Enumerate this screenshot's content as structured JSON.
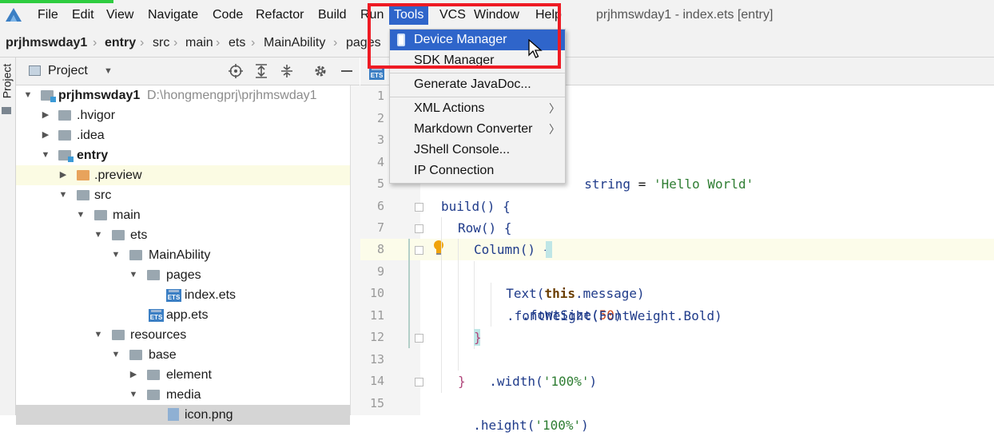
{
  "menu": {
    "items": [
      "File",
      "Edit",
      "View",
      "Navigate",
      "Code",
      "Refactor",
      "Build",
      "Run",
      "Tools",
      "VCS",
      "Window",
      "Help"
    ],
    "active": "Tools",
    "window_title": "prjhmswday1 - index.ets [entry]"
  },
  "breadcrumb": [
    "prjhmswday1",
    "entry",
    "src",
    "main",
    "ets",
    "MainAbility",
    "pages"
  ],
  "project_panel": {
    "title": "Project",
    "stripe_label": "Project",
    "tree": [
      {
        "label": "prjhmswday1",
        "path": "D:\\hongmengprj\\prjhmswday1",
        "bold": true
      },
      {
        "label": ".hvigor"
      },
      {
        "label": ".idea"
      },
      {
        "label": "entry",
        "bold": true
      },
      {
        "label": ".preview"
      },
      {
        "label": "src"
      },
      {
        "label": "main"
      },
      {
        "label": "ets"
      },
      {
        "label": "MainAbility"
      },
      {
        "label": "pages"
      },
      {
        "label": "index.ets"
      },
      {
        "label": "app.ets"
      },
      {
        "label": "resources"
      },
      {
        "label": "base"
      },
      {
        "label": "element"
      },
      {
        "label": "media"
      },
      {
        "label": "icon.png"
      }
    ]
  },
  "editor": {
    "line_numbers": [
      "1",
      "2",
      "3",
      "4",
      "5",
      "6",
      "7",
      "8",
      "9",
      "10",
      "11",
      "12",
      "13",
      "14",
      "15"
    ],
    "current_line": "8",
    "code": {
      "l4_type": "string",
      "l4_eq": "=",
      "l4_str": "'Hello World'",
      "l6": "build() {",
      "l7": "Row() {",
      "l8": "Column() {",
      "l9_fn": "Text(",
      "l9_kw": "this",
      "l9_rest": ".message)",
      "l10_fn": ".fontSize(",
      "l10_num": "50",
      "l10_end": ")",
      "l11": ".fontWeight(FontWeight.Bold)",
      "l12": "}",
      "l13_fn": ".width(",
      "l13_str": "'100%'",
      "l13_end": ")",
      "l14": "}",
      "l15_fn": ".height(",
      "l15_str": "'100%'",
      "l15_end": ")"
    }
  },
  "tools_menu": {
    "items": [
      "Device Manager",
      "SDK Manager",
      "Generate JavaDoc...",
      "XML Actions",
      "Markdown Converter",
      "JShell Console...",
      "IP Connection"
    ],
    "highlighted": "Device Manager"
  },
  "colors": {
    "accent": "#2f65ca",
    "highlight_box": "#ee1b24",
    "green_bar": "#2ecc40"
  }
}
